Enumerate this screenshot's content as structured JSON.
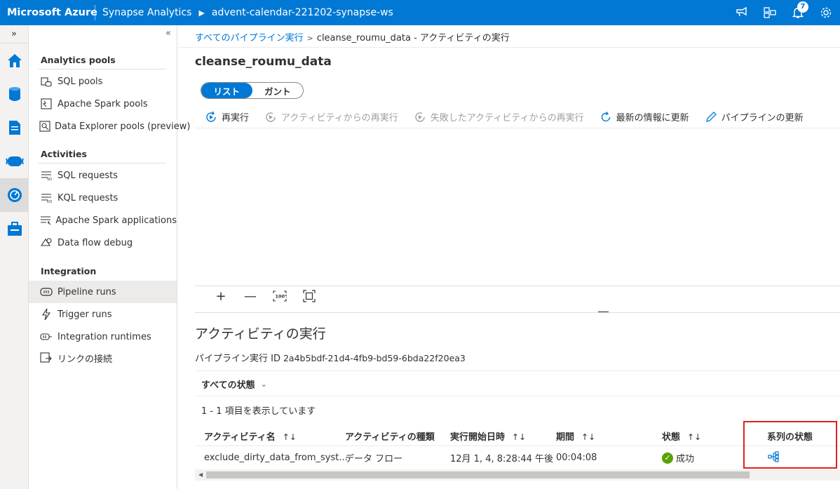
{
  "topbar": {
    "brand": "Microsoft Azure",
    "service": "Synapse Analytics",
    "workspace": "advent-calendar-221202-synapse-ws",
    "notification_count": "7",
    "icons": [
      "feedback-icon",
      "directory-icon",
      "bell-icon",
      "settings-icon"
    ]
  },
  "rail": {
    "icons": [
      "home-icon",
      "data-icon",
      "develop-icon",
      "integrate-icon",
      "monitor-icon",
      "manage-icon"
    ],
    "active": "monitor-icon"
  },
  "nav": {
    "sections": [
      {
        "title": "Analytics pools",
        "items": [
          "SQL pools",
          "Apache Spark pools",
          "Data Explorer pools (preview)"
        ]
      },
      {
        "title": "Activities",
        "items": [
          "SQL requests",
          "KQL requests",
          "Apache Spark applications",
          "Data flow debug"
        ]
      },
      {
        "title": "Integration",
        "items": [
          "Pipeline runs",
          "Trigger runs",
          "Integration runtimes",
          "リンクの接続"
        ]
      }
    ],
    "active_item": "Pipeline runs"
  },
  "breadcrumb": {
    "parent": "すべてのパイプライン実行",
    "current": "cleanse_roumu_data - アクティビティの実行"
  },
  "page_title": "cleanse_roumu_data",
  "view_toggle": {
    "list": "リスト",
    "gantt": "ガント",
    "selected": "list"
  },
  "toolbar": {
    "rerun": "再実行",
    "rerun_from_activity": "アクティビティからの再実行",
    "rerun_from_failed": "失敗したアクティビティからの再実行",
    "refresh": "最新の情報に更新",
    "update_pipeline": "パイプラインの更新"
  },
  "activity_runs": {
    "heading": "アクティビティの実行",
    "run_id_label": "パイプライン実行 ID",
    "run_id": "2a4b5bdf-21d4-4fb9-bd59-6bda22f20ea3",
    "status_filter": "すべての状態",
    "count_text": "1 - 1 項目を表示しています",
    "columns": {
      "name": "アクティビティ名",
      "type": "アクティビティの種類",
      "start": "実行開始日時",
      "duration": "期間",
      "status": "状態",
      "lineage": "系列の状態"
    },
    "rows": [
      {
        "name": "exclude_dirty_data_from_syst...",
        "type": "データ フロー",
        "start": "12月 1, 4, 8:28:44 午後",
        "duration": "00:04:08",
        "status": "成功"
      }
    ]
  },
  "colors": {
    "accent": "#0078d4",
    "success": "#57a300",
    "highlight": "#e02020"
  }
}
